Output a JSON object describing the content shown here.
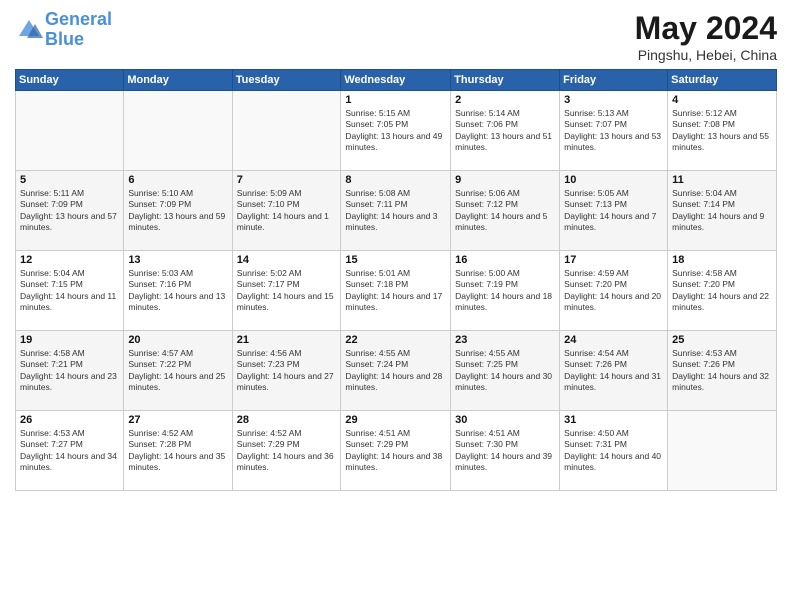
{
  "header": {
    "logo_line1": "General",
    "logo_line2": "Blue",
    "month": "May 2024",
    "location": "Pingshu, Hebei, China"
  },
  "weekdays": [
    "Sunday",
    "Monday",
    "Tuesday",
    "Wednesday",
    "Thursday",
    "Friday",
    "Saturday"
  ],
  "weeks": [
    [
      {
        "day": "",
        "sunrise": "",
        "sunset": "",
        "daylight": ""
      },
      {
        "day": "",
        "sunrise": "",
        "sunset": "",
        "daylight": ""
      },
      {
        "day": "",
        "sunrise": "",
        "sunset": "",
        "daylight": ""
      },
      {
        "day": "1",
        "sunrise": "Sunrise: 5:15 AM",
        "sunset": "Sunset: 7:05 PM",
        "daylight": "Daylight: 13 hours and 49 minutes."
      },
      {
        "day": "2",
        "sunrise": "Sunrise: 5:14 AM",
        "sunset": "Sunset: 7:06 PM",
        "daylight": "Daylight: 13 hours and 51 minutes."
      },
      {
        "day": "3",
        "sunrise": "Sunrise: 5:13 AM",
        "sunset": "Sunset: 7:07 PM",
        "daylight": "Daylight: 13 hours and 53 minutes."
      },
      {
        "day": "4",
        "sunrise": "Sunrise: 5:12 AM",
        "sunset": "Sunset: 7:08 PM",
        "daylight": "Daylight: 13 hours and 55 minutes."
      }
    ],
    [
      {
        "day": "5",
        "sunrise": "Sunrise: 5:11 AM",
        "sunset": "Sunset: 7:09 PM",
        "daylight": "Daylight: 13 hours and 57 minutes."
      },
      {
        "day": "6",
        "sunrise": "Sunrise: 5:10 AM",
        "sunset": "Sunset: 7:09 PM",
        "daylight": "Daylight: 13 hours and 59 minutes."
      },
      {
        "day": "7",
        "sunrise": "Sunrise: 5:09 AM",
        "sunset": "Sunset: 7:10 PM",
        "daylight": "Daylight: 14 hours and 1 minute."
      },
      {
        "day": "8",
        "sunrise": "Sunrise: 5:08 AM",
        "sunset": "Sunset: 7:11 PM",
        "daylight": "Daylight: 14 hours and 3 minutes."
      },
      {
        "day": "9",
        "sunrise": "Sunrise: 5:06 AM",
        "sunset": "Sunset: 7:12 PM",
        "daylight": "Daylight: 14 hours and 5 minutes."
      },
      {
        "day": "10",
        "sunrise": "Sunrise: 5:05 AM",
        "sunset": "Sunset: 7:13 PM",
        "daylight": "Daylight: 14 hours and 7 minutes."
      },
      {
        "day": "11",
        "sunrise": "Sunrise: 5:04 AM",
        "sunset": "Sunset: 7:14 PM",
        "daylight": "Daylight: 14 hours and 9 minutes."
      }
    ],
    [
      {
        "day": "12",
        "sunrise": "Sunrise: 5:04 AM",
        "sunset": "Sunset: 7:15 PM",
        "daylight": "Daylight: 14 hours and 11 minutes."
      },
      {
        "day": "13",
        "sunrise": "Sunrise: 5:03 AM",
        "sunset": "Sunset: 7:16 PM",
        "daylight": "Daylight: 14 hours and 13 minutes."
      },
      {
        "day": "14",
        "sunrise": "Sunrise: 5:02 AM",
        "sunset": "Sunset: 7:17 PM",
        "daylight": "Daylight: 14 hours and 15 minutes."
      },
      {
        "day": "15",
        "sunrise": "Sunrise: 5:01 AM",
        "sunset": "Sunset: 7:18 PM",
        "daylight": "Daylight: 14 hours and 17 minutes."
      },
      {
        "day": "16",
        "sunrise": "Sunrise: 5:00 AM",
        "sunset": "Sunset: 7:19 PM",
        "daylight": "Daylight: 14 hours and 18 minutes."
      },
      {
        "day": "17",
        "sunrise": "Sunrise: 4:59 AM",
        "sunset": "Sunset: 7:20 PM",
        "daylight": "Daylight: 14 hours and 20 minutes."
      },
      {
        "day": "18",
        "sunrise": "Sunrise: 4:58 AM",
        "sunset": "Sunset: 7:20 PM",
        "daylight": "Daylight: 14 hours and 22 minutes."
      }
    ],
    [
      {
        "day": "19",
        "sunrise": "Sunrise: 4:58 AM",
        "sunset": "Sunset: 7:21 PM",
        "daylight": "Daylight: 14 hours and 23 minutes."
      },
      {
        "day": "20",
        "sunrise": "Sunrise: 4:57 AM",
        "sunset": "Sunset: 7:22 PM",
        "daylight": "Daylight: 14 hours and 25 minutes."
      },
      {
        "day": "21",
        "sunrise": "Sunrise: 4:56 AM",
        "sunset": "Sunset: 7:23 PM",
        "daylight": "Daylight: 14 hours and 27 minutes."
      },
      {
        "day": "22",
        "sunrise": "Sunrise: 4:55 AM",
        "sunset": "Sunset: 7:24 PM",
        "daylight": "Daylight: 14 hours and 28 minutes."
      },
      {
        "day": "23",
        "sunrise": "Sunrise: 4:55 AM",
        "sunset": "Sunset: 7:25 PM",
        "daylight": "Daylight: 14 hours and 30 minutes."
      },
      {
        "day": "24",
        "sunrise": "Sunrise: 4:54 AM",
        "sunset": "Sunset: 7:26 PM",
        "daylight": "Daylight: 14 hours and 31 minutes."
      },
      {
        "day": "25",
        "sunrise": "Sunrise: 4:53 AM",
        "sunset": "Sunset: 7:26 PM",
        "daylight": "Daylight: 14 hours and 32 minutes."
      }
    ],
    [
      {
        "day": "26",
        "sunrise": "Sunrise: 4:53 AM",
        "sunset": "Sunset: 7:27 PM",
        "daylight": "Daylight: 14 hours and 34 minutes."
      },
      {
        "day": "27",
        "sunrise": "Sunrise: 4:52 AM",
        "sunset": "Sunset: 7:28 PM",
        "daylight": "Daylight: 14 hours and 35 minutes."
      },
      {
        "day": "28",
        "sunrise": "Sunrise: 4:52 AM",
        "sunset": "Sunset: 7:29 PM",
        "daylight": "Daylight: 14 hours and 36 minutes."
      },
      {
        "day": "29",
        "sunrise": "Sunrise: 4:51 AM",
        "sunset": "Sunset: 7:29 PM",
        "daylight": "Daylight: 14 hours and 38 minutes."
      },
      {
        "day": "30",
        "sunrise": "Sunrise: 4:51 AM",
        "sunset": "Sunset: 7:30 PM",
        "daylight": "Daylight: 14 hours and 39 minutes."
      },
      {
        "day": "31",
        "sunrise": "Sunrise: 4:50 AM",
        "sunset": "Sunset: 7:31 PM",
        "daylight": "Daylight: 14 hours and 40 minutes."
      },
      {
        "day": "",
        "sunrise": "",
        "sunset": "",
        "daylight": ""
      }
    ]
  ]
}
